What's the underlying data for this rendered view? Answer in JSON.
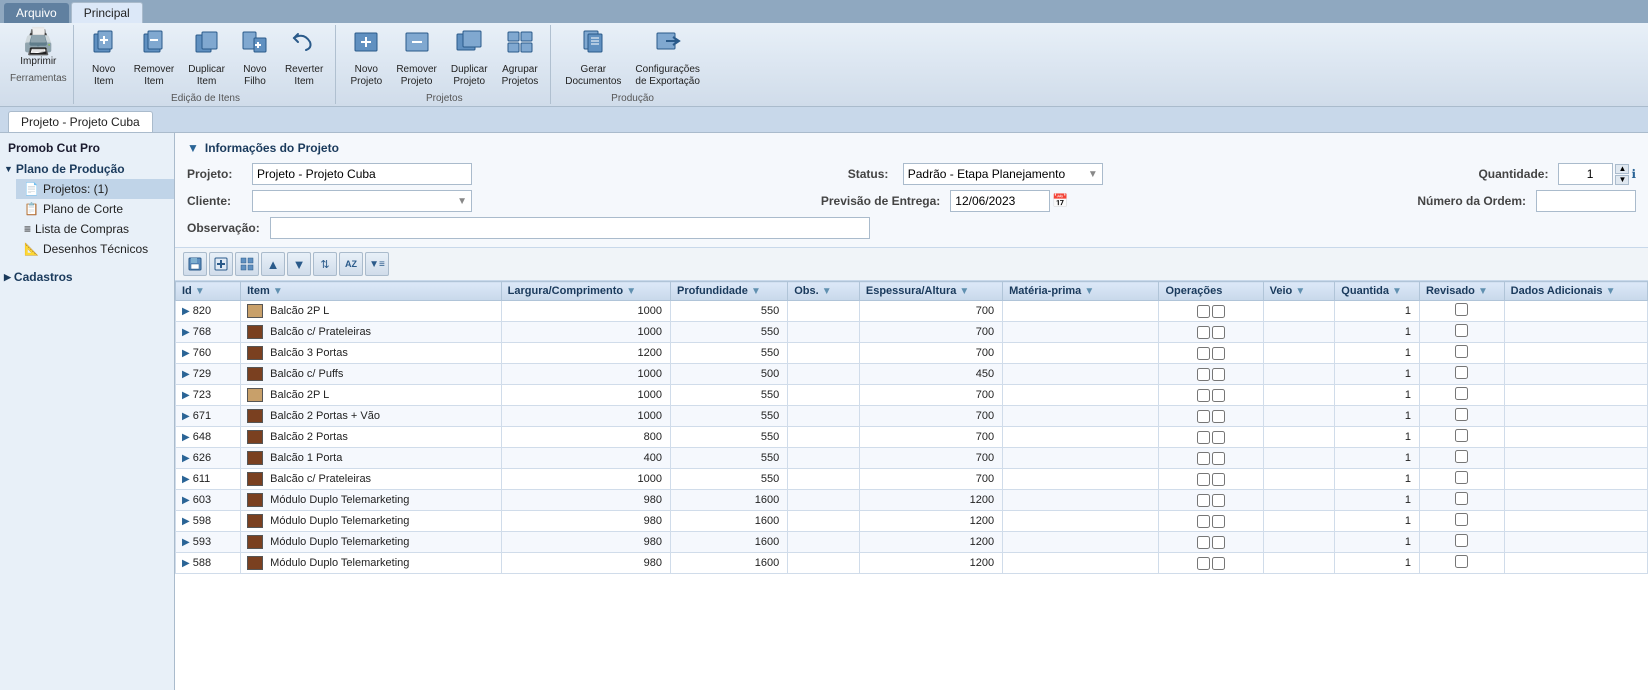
{
  "app": {
    "title": "Promob Cut Pro"
  },
  "top_tabs": [
    {
      "id": "arquivo",
      "label": "Arquivo",
      "active": false
    },
    {
      "id": "principal",
      "label": "Principal",
      "active": true
    }
  ],
  "toolbar": {
    "groups": [
      {
        "id": "ferramentas",
        "label": "Ferramentas",
        "buttons": [
          {
            "id": "imprimir",
            "label": "Imprimir",
            "icon": "🖨️"
          }
        ]
      },
      {
        "id": "edicao-itens",
        "label": "Edição de Itens",
        "buttons": [
          {
            "id": "novo-item",
            "label": "Novo\nItem",
            "icon": "📦"
          },
          {
            "id": "remover-item",
            "label": "Remover\nItem",
            "icon": "📦"
          },
          {
            "id": "duplicar-item",
            "label": "Duplicar\nItem",
            "icon": "📦"
          },
          {
            "id": "novo-filho",
            "label": "Novo\nFilho",
            "icon": "📄"
          },
          {
            "id": "reverter-item",
            "label": "Reverter\nItem",
            "icon": "↩️"
          }
        ]
      },
      {
        "id": "projetos",
        "label": "Projetos",
        "buttons": [
          {
            "id": "novo-projeto",
            "label": "Novo\nProjeto",
            "icon": "📋"
          },
          {
            "id": "remover-projeto",
            "label": "Remover\nProjeto",
            "icon": "📋"
          },
          {
            "id": "duplicar-projeto",
            "label": "Duplicar\nProjeto",
            "icon": "📋"
          },
          {
            "id": "agrupar-projetos",
            "label": "Agrupar\nProjetos",
            "icon": "📁"
          }
        ]
      },
      {
        "id": "producao",
        "label": "Produção",
        "buttons": [
          {
            "id": "gerar-documentos",
            "label": "Gerar\nDocumentos",
            "icon": "📄"
          },
          {
            "id": "configuracoes-exportacao",
            "label": "Configurações\nde Exportação",
            "icon": "⚙️"
          }
        ]
      }
    ]
  },
  "project_tab": {
    "label": "Projeto - Projeto Cuba"
  },
  "sidebar": {
    "title": "Promob Cut Pro",
    "items": [
      {
        "id": "plano-producao",
        "label": "Plano de Produção",
        "type": "section",
        "expanded": true
      },
      {
        "id": "projetos",
        "label": "Projetos: (1)",
        "type": "sub",
        "icon": "📄"
      },
      {
        "id": "plano-corte",
        "label": "Plano de Corte",
        "type": "sub",
        "icon": "📋"
      },
      {
        "id": "lista-compras",
        "label": "Lista de Compras",
        "type": "sub",
        "icon": "≡"
      },
      {
        "id": "desenhos-tecnicos",
        "label": "Desenhos Técnicos",
        "type": "sub",
        "icon": "📐"
      },
      {
        "id": "cadastros",
        "label": "Cadastros",
        "type": "section",
        "expanded": false
      }
    ]
  },
  "project_info": {
    "section_title": "Informações do Projeto",
    "fields": {
      "projeto_label": "Projeto:",
      "projeto_value": "Projeto - Projeto Cuba",
      "status_label": "Status:",
      "status_value": "Padrão - Etapa Planejamento",
      "quantidade_label": "Quantidade:",
      "quantidade_value": "1",
      "cliente_label": "Cliente:",
      "cliente_value": "",
      "previsao_label": "Previsão de Entrega:",
      "previsao_value": "12/06/2023",
      "numero_label": "Número da Ordem:",
      "numero_value": "",
      "observacao_label": "Observação:",
      "observacao_value": ""
    }
  },
  "grid_buttons": [
    {
      "id": "btn-save",
      "icon": "💾"
    },
    {
      "id": "btn-add",
      "icon": "➕"
    },
    {
      "id": "btn-grid",
      "icon": "▦"
    },
    {
      "id": "btn-up",
      "icon": "▲"
    },
    {
      "id": "btn-down",
      "icon": "▼"
    },
    {
      "id": "btn-sort",
      "icon": "⇅"
    },
    {
      "id": "btn-az",
      "icon": "AZ"
    },
    {
      "id": "btn-filter",
      "icon": "▼≡"
    }
  ],
  "table": {
    "columns": [
      {
        "id": "id",
        "label": "Id",
        "filterable": true
      },
      {
        "id": "item",
        "label": "Item",
        "filterable": true
      },
      {
        "id": "largura",
        "label": "Largura/Comprimento",
        "filterable": true
      },
      {
        "id": "profundidade",
        "label": "Profundidade",
        "filterable": true
      },
      {
        "id": "obs",
        "label": "Obs.",
        "filterable": true
      },
      {
        "id": "espessura",
        "label": "Espessura/Altura",
        "filterable": true
      },
      {
        "id": "materia",
        "label": "Matéria-prima",
        "filterable": true
      },
      {
        "id": "operacoes",
        "label": "Operações",
        "filterable": false
      },
      {
        "id": "veio",
        "label": "Veio",
        "filterable": true
      },
      {
        "id": "quantidade",
        "label": "Quantida",
        "filterable": true
      },
      {
        "id": "revisado",
        "label": "Revisado",
        "filterable": true
      },
      {
        "id": "dados",
        "label": "Dados Adicionais",
        "filterable": true
      }
    ],
    "rows": [
      {
        "id": "820",
        "item": "Balcão 2P L",
        "largura": "1000",
        "profundidade": "550",
        "obs": "",
        "espessura": "700",
        "materia": "",
        "operacoes": "",
        "veio": "",
        "quantidade": "1",
        "revisado": "",
        "dados": ""
      },
      {
        "id": "768",
        "item": "Balcão c/ Prateleiras",
        "largura": "1000",
        "profundidade": "550",
        "obs": "",
        "espessura": "700",
        "materia": "",
        "operacoes": "",
        "veio": "",
        "quantidade": "1",
        "revisado": "",
        "dados": ""
      },
      {
        "id": "760",
        "item": "Balcão 3 Portas",
        "largura": "1200",
        "profundidade": "550",
        "obs": "",
        "espessura": "700",
        "materia": "",
        "operacoes": "",
        "veio": "",
        "quantidade": "1",
        "revisado": "",
        "dados": ""
      },
      {
        "id": "729",
        "item": "Balcão c/ Puffs",
        "largura": "1000",
        "profundidade": "500",
        "obs": "",
        "espessura": "450",
        "materia": "",
        "operacoes": "",
        "veio": "",
        "quantidade": "1",
        "revisado": "",
        "dados": ""
      },
      {
        "id": "723",
        "item": "Balcão 2P L",
        "largura": "1000",
        "profundidade": "550",
        "obs": "",
        "espessura": "700",
        "materia": "",
        "operacoes": "",
        "veio": "",
        "quantidade": "1",
        "revisado": "",
        "dados": ""
      },
      {
        "id": "671",
        "item": "Balcão 2 Portas + Vão",
        "largura": "1000",
        "profundidade": "550",
        "obs": "",
        "espessura": "700",
        "materia": "",
        "operacoes": "",
        "veio": "",
        "quantidade": "1",
        "revisado": "",
        "dados": ""
      },
      {
        "id": "648",
        "item": "Balcão 2 Portas",
        "largura": "800",
        "profundidade": "550",
        "obs": "",
        "espessura": "700",
        "materia": "",
        "operacoes": "",
        "veio": "",
        "quantidade": "1",
        "revisado": "",
        "dados": ""
      },
      {
        "id": "626",
        "item": "Balcão 1 Porta",
        "largura": "400",
        "profundidade": "550",
        "obs": "",
        "espessura": "700",
        "materia": "",
        "operacoes": "",
        "veio": "",
        "quantidade": "1",
        "revisado": "",
        "dados": ""
      },
      {
        "id": "611",
        "item": "Balcão c/ Prateleiras",
        "largura": "1000",
        "profundidade": "550",
        "obs": "",
        "espessura": "700",
        "materia": "",
        "operacoes": "",
        "veio": "",
        "quantidade": "1",
        "revisado": "",
        "dados": ""
      },
      {
        "id": "603",
        "item": "Módulo Duplo Telemarketing",
        "largura": "980",
        "profundidade": "1600",
        "obs": "",
        "espessura": "1200",
        "materia": "",
        "operacoes": "",
        "veio": "",
        "quantidade": "1",
        "revisado": "",
        "dados": ""
      },
      {
        "id": "598",
        "item": "Módulo Duplo Telemarketing",
        "largura": "980",
        "profundidade": "1600",
        "obs": "",
        "espessura": "1200",
        "materia": "",
        "operacoes": "",
        "veio": "",
        "quantidade": "1",
        "revisado": "",
        "dados": ""
      },
      {
        "id": "593",
        "item": "Módulo Duplo Telemarketing",
        "largura": "980",
        "profundidade": "1600",
        "obs": "",
        "espessura": "1200",
        "materia": "",
        "operacoes": "",
        "veio": "",
        "quantidade": "1",
        "revisado": "",
        "dados": ""
      },
      {
        "id": "588",
        "item": "Módulo Duplo Telemarketing",
        "largura": "980",
        "profundidade": "1600",
        "obs": "",
        "espessura": "1200",
        "materia": "",
        "operacoes": "",
        "veio": "",
        "quantidade": "1",
        "revisado": "",
        "dados": ""
      }
    ]
  }
}
